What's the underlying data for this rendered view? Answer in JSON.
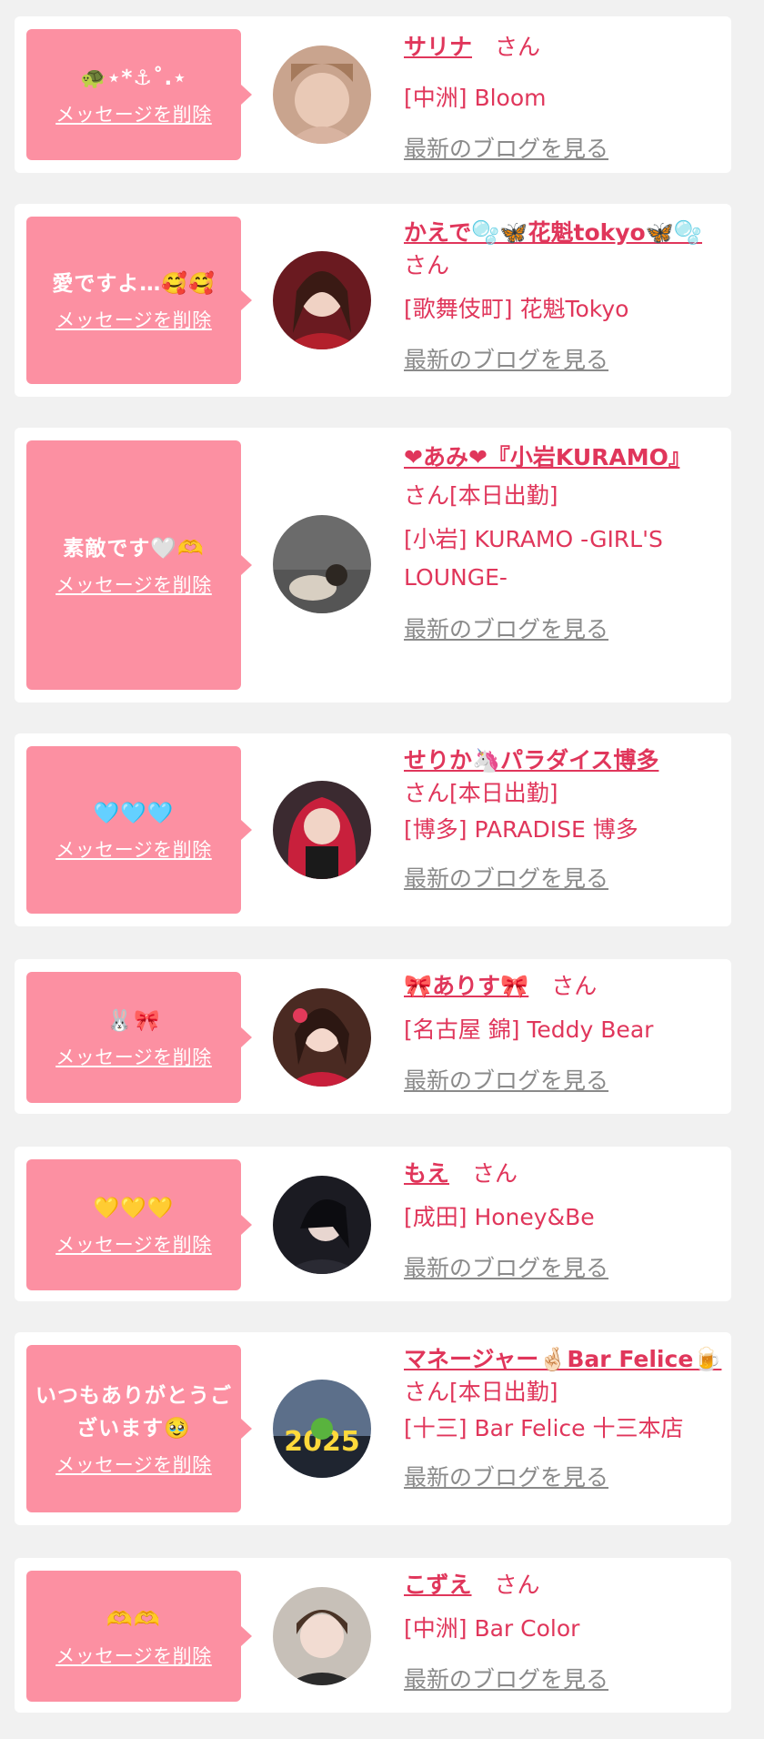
{
  "common": {
    "delete_label": "メッセージを削除",
    "blog_label": "最新のブログを見る",
    "san": "さん",
    "accent_color": "#e0365b",
    "bubble_color": "#fc90a2"
  },
  "messages": [
    {
      "message": "🐢⋆*⚓︎˚.⋆",
      "name": "サリナ",
      "status": "",
      "shop": "[中洲] Bloom"
    },
    {
      "message": "愛ですよ…🥰🥰",
      "name": "かえで🫧🦋花魁tokyo🦋🫧",
      "status": "",
      "shop": "[歌舞伎町] 花魁Tokyo"
    },
    {
      "message": "素敵です🤍🫶",
      "name": "❤あみ❤『小岩KURAMO』",
      "status": "[本日出勤]",
      "shop": "[小岩] KURAMO -GIRL'S LOUNGE-"
    },
    {
      "message": "🩵🩵🩵",
      "name": "せりか🦄パラダイス博多",
      "status": "[本日出勤]",
      "shop": "[博多] PARADISE 博多"
    },
    {
      "message": "🐰🎀",
      "name": "🎀ありす🎀",
      "status": "",
      "shop": "[名古屋 錦] Teddy Bear"
    },
    {
      "message": "💛💛💛",
      "name": "もえ",
      "status": "",
      "shop": "[成田] Honey&Be"
    },
    {
      "message": "いつもありがとうございます🥹",
      "name": "マネージャー🤞🏻Bar Felice🍺",
      "status": "[本日出勤]",
      "shop": "[十三] Bar Felice 十三本店"
    },
    {
      "message": "🫶🫶",
      "name": "こずえ",
      "status": "",
      "shop": "[中洲] Bar Color"
    }
  ]
}
